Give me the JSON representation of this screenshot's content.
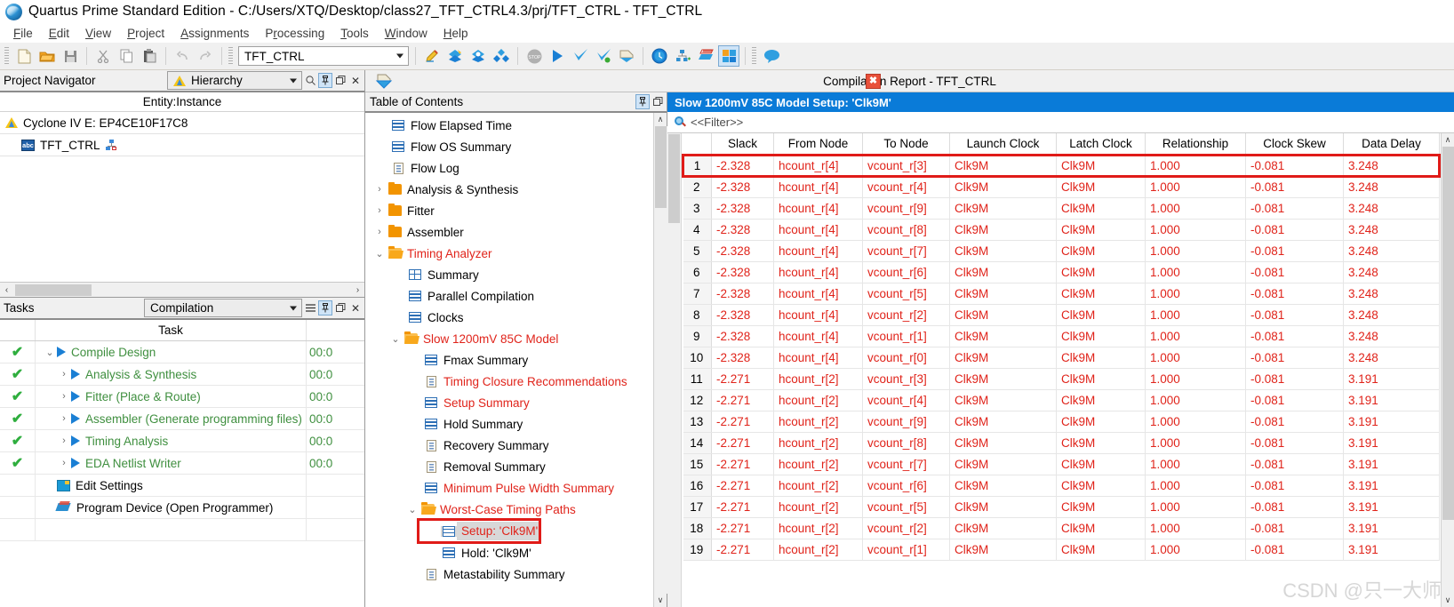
{
  "window": {
    "title": "Quartus Prime Standard Edition - C:/Users/XTQ/Desktop/class27_TFT_CTRL4.3/prj/TFT_CTRL - TFT_CTRL",
    "logo_icon": "quartus-sphere-icon"
  },
  "menubar": [
    {
      "label": "File",
      "mnemonic": "F"
    },
    {
      "label": "Edit",
      "mnemonic": "E"
    },
    {
      "label": "View",
      "mnemonic": "V"
    },
    {
      "label": "Project",
      "mnemonic": "P"
    },
    {
      "label": "Assignments",
      "mnemonic": "A"
    },
    {
      "label": "Processing",
      "mnemonic": "r"
    },
    {
      "label": "Tools",
      "mnemonic": "T"
    },
    {
      "label": "Window",
      "mnemonic": "W"
    },
    {
      "label": "Help",
      "mnemonic": "H"
    }
  ],
  "toolbar": {
    "project_combo_value": "TFT_CTRL",
    "buttons": [
      "new-file-icon",
      "open-folder-icon",
      "save-icon",
      "cut-icon",
      "copy-icon",
      "paste-icon",
      "undo-icon",
      "redo-icon"
    ],
    "buttons2": [
      "pencil-edit-icon",
      "compile-all-icon",
      "compile-analysis-icon",
      "compile-flow-icon",
      "stop-icon",
      "start-compilation-icon",
      "analysis-synthesis-icon",
      "fitter-check-icon",
      "assembler-icon",
      "timing-analyzer-icon",
      "pin-planner-icon",
      "programmer-icon",
      "chip-planner-icon",
      "message-bubble-icon"
    ]
  },
  "project_navigator": {
    "title": "Project Navigator",
    "view_selector": "Hierarchy",
    "view_icon": "quartus-triangle-icon",
    "header_icons": [
      "search-icon",
      "pin-icon",
      "undock-icon",
      "close-icon"
    ],
    "column_header": "Entity:Instance",
    "rows": [
      {
        "label": "Cyclone IV E: EP4CE10F17C8",
        "icon": "quartus-triangle-icon",
        "indent": 0
      },
      {
        "label": "TFT_CTRL",
        "icon": "abc-entity-icon",
        "indent": 1,
        "badge": "hierarchy-badge-icon"
      }
    ]
  },
  "tasks": {
    "title": "Tasks",
    "flow_selector": "Compilation",
    "header_icons": [
      "list-icon",
      "pin-icon",
      "undock-icon",
      "close-icon"
    ],
    "column_header": "Task",
    "rows": [
      {
        "status": "✔",
        "label": "Compile Design",
        "time": "00:0",
        "indent": 0,
        "expander": "⌄",
        "play": true,
        "green": true
      },
      {
        "status": "✔",
        "label": "Analysis & Synthesis",
        "time": "00:0",
        "indent": 1,
        "expander": "›",
        "play": true,
        "green": true
      },
      {
        "status": "✔",
        "label": "Fitter (Place & Route)",
        "time": "00:0",
        "indent": 1,
        "expander": "›",
        "play": true,
        "green": true
      },
      {
        "status": "✔",
        "label": "Assembler (Generate programming files)",
        "time": "00:0",
        "indent": 1,
        "expander": "›",
        "play": true,
        "green": true
      },
      {
        "status": "✔",
        "label": "Timing Analysis",
        "time": "00:0",
        "indent": 1,
        "expander": "›",
        "play": true,
        "green": true
      },
      {
        "status": "✔",
        "label": "EDA Netlist Writer",
        "time": "00:0",
        "indent": 1,
        "expander": "›",
        "play": true,
        "green": true
      },
      {
        "status": "",
        "label": "Edit Settings",
        "time": "",
        "indent": 1,
        "expander": "",
        "play": false,
        "green": false,
        "icon": "settings-icon"
      },
      {
        "status": "",
        "label": "Program Device (Open Programmer)",
        "time": "",
        "indent": 1,
        "expander": "",
        "play": false,
        "green": false,
        "icon": "programmer-icon"
      }
    ]
  },
  "report": {
    "title": "Compilation Report - TFT_CTRL",
    "icon": "report-diamond-icon",
    "close_label": "✖",
    "toc": {
      "header": "Table of Contents",
      "header_icons": [
        "pin-icon",
        "undock-icon"
      ],
      "items": [
        {
          "label": "Flow Elapsed Time",
          "icon": "table-icon",
          "indent": 1,
          "expander": "",
          "red": false
        },
        {
          "label": "Flow OS Summary",
          "icon": "table-icon",
          "indent": 1,
          "expander": "",
          "red": false
        },
        {
          "label": "Flow Log",
          "icon": "doc-icon",
          "indent": 1,
          "expander": "",
          "red": false
        },
        {
          "label": "Analysis & Synthesis",
          "icon": "folder-icon",
          "indent": 0,
          "expander": "›",
          "red": false
        },
        {
          "label": "Fitter",
          "icon": "folder-icon",
          "indent": 0,
          "expander": "›",
          "red": false
        },
        {
          "label": "Assembler",
          "icon": "folder-icon",
          "indent": 0,
          "expander": "›",
          "red": false
        },
        {
          "label": "Timing Analyzer",
          "icon": "folder-open-icon",
          "indent": 0,
          "expander": "⌄",
          "red": true
        },
        {
          "label": "Summary",
          "icon": "table-grid-icon",
          "indent": 2,
          "expander": "",
          "red": false
        },
        {
          "label": "Parallel Compilation",
          "icon": "table-icon",
          "indent": 2,
          "expander": "",
          "red": false
        },
        {
          "label": "Clocks",
          "icon": "table-icon",
          "indent": 2,
          "expander": "",
          "red": false
        },
        {
          "label": "Slow 1200mV 85C Model",
          "icon": "folder-open-icon",
          "indent": 1,
          "expander": "⌄",
          "red": true
        },
        {
          "label": "Fmax Summary",
          "icon": "table-icon",
          "indent": 3,
          "expander": "",
          "red": false
        },
        {
          "label": "Timing Closure Recommendations",
          "icon": "doc-icon",
          "indent": 3,
          "expander": "",
          "red": true
        },
        {
          "label": "Setup Summary",
          "icon": "table-icon",
          "indent": 3,
          "expander": "",
          "red": true
        },
        {
          "label": "Hold Summary",
          "icon": "table-icon",
          "indent": 3,
          "expander": "",
          "red": false
        },
        {
          "label": "Recovery Summary",
          "icon": "doc-icon",
          "indent": 3,
          "expander": "",
          "red": false
        },
        {
          "label": "Removal Summary",
          "icon": "doc-icon",
          "indent": 3,
          "expander": "",
          "red": false
        },
        {
          "label": "Minimum Pulse Width Summary",
          "icon": "table-icon",
          "indent": 3,
          "expander": "",
          "red": true
        },
        {
          "label": "Worst-Case Timing Paths",
          "icon": "folder-open-icon",
          "indent": 2,
          "expander": "⌄",
          "red": true
        },
        {
          "label": "Setup: 'Clk9M'",
          "icon": "table-icon",
          "indent": 4,
          "expander": "",
          "red": true,
          "selected": true,
          "highlighted": true
        },
        {
          "label": "Hold: 'Clk9M'",
          "icon": "table-icon",
          "indent": 4,
          "expander": "",
          "red": false
        },
        {
          "label": "Metastability Summary",
          "icon": "doc-icon",
          "indent": 3,
          "expander": "",
          "red": false
        }
      ]
    },
    "banner": "Slow 1200mV 85C Model Setup: 'Clk9M'",
    "filter": {
      "icon": "search-icon",
      "placeholder": "<<Filter>>",
      "value": "<<Filter>>"
    },
    "table": {
      "columns": [
        "",
        "Slack",
        "From Node",
        "To Node",
        "Launch Clock",
        "Latch Clock",
        "Relationship",
        "Clock Skew",
        "Data Delay"
      ],
      "rows": [
        {
          "n": "1",
          "slack": "-2.328",
          "from": "hcount_r[4]",
          "to": "vcount_r[3]",
          "launch": "Clk9M",
          "latch": "Clk9M",
          "rel": "1.000",
          "skew": "-0.081",
          "delay": "3.248",
          "highlighted": true
        },
        {
          "n": "2",
          "slack": "-2.328",
          "from": "hcount_r[4]",
          "to": "vcount_r[4]",
          "launch": "Clk9M",
          "latch": "Clk9M",
          "rel": "1.000",
          "skew": "-0.081",
          "delay": "3.248"
        },
        {
          "n": "3",
          "slack": "-2.328",
          "from": "hcount_r[4]",
          "to": "vcount_r[9]",
          "launch": "Clk9M",
          "latch": "Clk9M",
          "rel": "1.000",
          "skew": "-0.081",
          "delay": "3.248"
        },
        {
          "n": "4",
          "slack": "-2.328",
          "from": "hcount_r[4]",
          "to": "vcount_r[8]",
          "launch": "Clk9M",
          "latch": "Clk9M",
          "rel": "1.000",
          "skew": "-0.081",
          "delay": "3.248"
        },
        {
          "n": "5",
          "slack": "-2.328",
          "from": "hcount_r[4]",
          "to": "vcount_r[7]",
          "launch": "Clk9M",
          "latch": "Clk9M",
          "rel": "1.000",
          "skew": "-0.081",
          "delay": "3.248"
        },
        {
          "n": "6",
          "slack": "-2.328",
          "from": "hcount_r[4]",
          "to": "vcount_r[6]",
          "launch": "Clk9M",
          "latch": "Clk9M",
          "rel": "1.000",
          "skew": "-0.081",
          "delay": "3.248"
        },
        {
          "n": "7",
          "slack": "-2.328",
          "from": "hcount_r[4]",
          "to": "vcount_r[5]",
          "launch": "Clk9M",
          "latch": "Clk9M",
          "rel": "1.000",
          "skew": "-0.081",
          "delay": "3.248"
        },
        {
          "n": "8",
          "slack": "-2.328",
          "from": "hcount_r[4]",
          "to": "vcount_r[2]",
          "launch": "Clk9M",
          "latch": "Clk9M",
          "rel": "1.000",
          "skew": "-0.081",
          "delay": "3.248"
        },
        {
          "n": "9",
          "slack": "-2.328",
          "from": "hcount_r[4]",
          "to": "vcount_r[1]",
          "launch": "Clk9M",
          "latch": "Clk9M",
          "rel": "1.000",
          "skew": "-0.081",
          "delay": "3.248"
        },
        {
          "n": "10",
          "slack": "-2.328",
          "from": "hcount_r[4]",
          "to": "vcount_r[0]",
          "launch": "Clk9M",
          "latch": "Clk9M",
          "rel": "1.000",
          "skew": "-0.081",
          "delay": "3.248"
        },
        {
          "n": "11",
          "slack": "-2.271",
          "from": "hcount_r[2]",
          "to": "vcount_r[3]",
          "launch": "Clk9M",
          "latch": "Clk9M",
          "rel": "1.000",
          "skew": "-0.081",
          "delay": "3.191"
        },
        {
          "n": "12",
          "slack": "-2.271",
          "from": "hcount_r[2]",
          "to": "vcount_r[4]",
          "launch": "Clk9M",
          "latch": "Clk9M",
          "rel": "1.000",
          "skew": "-0.081",
          "delay": "3.191"
        },
        {
          "n": "13",
          "slack": "-2.271",
          "from": "hcount_r[2]",
          "to": "vcount_r[9]",
          "launch": "Clk9M",
          "latch": "Clk9M",
          "rel": "1.000",
          "skew": "-0.081",
          "delay": "3.191"
        },
        {
          "n": "14",
          "slack": "-2.271",
          "from": "hcount_r[2]",
          "to": "vcount_r[8]",
          "launch": "Clk9M",
          "latch": "Clk9M",
          "rel": "1.000",
          "skew": "-0.081",
          "delay": "3.191"
        },
        {
          "n": "15",
          "slack": "-2.271",
          "from": "hcount_r[2]",
          "to": "vcount_r[7]",
          "launch": "Clk9M",
          "latch": "Clk9M",
          "rel": "1.000",
          "skew": "-0.081",
          "delay": "3.191"
        },
        {
          "n": "16",
          "slack": "-2.271",
          "from": "hcount_r[2]",
          "to": "vcount_r[6]",
          "launch": "Clk9M",
          "latch": "Clk9M",
          "rel": "1.000",
          "skew": "-0.081",
          "delay": "3.191"
        },
        {
          "n": "17",
          "slack": "-2.271",
          "from": "hcount_r[2]",
          "to": "vcount_r[5]",
          "launch": "Clk9M",
          "latch": "Clk9M",
          "rel": "1.000",
          "skew": "-0.081",
          "delay": "3.191"
        },
        {
          "n": "18",
          "slack": "-2.271",
          "from": "hcount_r[2]",
          "to": "vcount_r[2]",
          "launch": "Clk9M",
          "latch": "Clk9M",
          "rel": "1.000",
          "skew": "-0.081",
          "delay": "3.191"
        },
        {
          "n": "19",
          "slack": "-2.271",
          "from": "hcount_r[2]",
          "to": "vcount_r[1]",
          "launch": "Clk9M",
          "latch": "Clk9M",
          "rel": "1.000",
          "skew": "-0.081",
          "delay": "3.191"
        }
      ]
    }
  },
  "watermark": "CSDN @只一大师",
  "colors": {
    "banner_blue": "#0a7bd8",
    "error_red": "#e0231a",
    "highlight_red": "#e01b18",
    "task_green": "#3f8f3f",
    "folder_orange": "#f29400"
  }
}
